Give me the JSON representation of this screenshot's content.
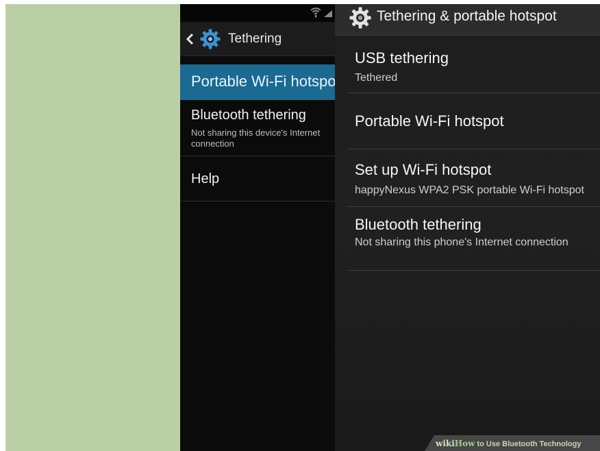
{
  "left_phone": {
    "title": "Tethering",
    "items": [
      {
        "title": "Portable Wi-Fi hotspot",
        "selected": true
      },
      {
        "title": "Bluetooth tethering",
        "summary": "Not sharing this device's Internet connection"
      },
      {
        "title": "Help"
      }
    ],
    "icons": [
      "wifi-icon",
      "signal-icon",
      "chevron-left-icon",
      "gear-icon"
    ]
  },
  "right_phone": {
    "title": "Tethering & portable hotspot",
    "items": [
      {
        "title": "USB tethering",
        "summary": "Tethered"
      },
      {
        "title": "Portable Wi-Fi hotspot"
      },
      {
        "title": "Set up Wi-Fi hotspot",
        "summary": "happyNexus WPA2 PSK portable Wi-Fi hotspot"
      },
      {
        "title": "Bluetooth tethering",
        "summary": "Not sharing this phone's Internet connection"
      }
    ],
    "icons": [
      "gear-icon"
    ]
  },
  "watermark": {
    "brand_wiki": "wiki",
    "brand_how": "How",
    "text": " to Use Bluetooth Technology"
  },
  "colors": {
    "background_green": "#bacfa5",
    "selected_item_blue": "#1b6a92",
    "dark_background": "#0b0b0b",
    "right_actionbar": "#2c2c2c"
  }
}
